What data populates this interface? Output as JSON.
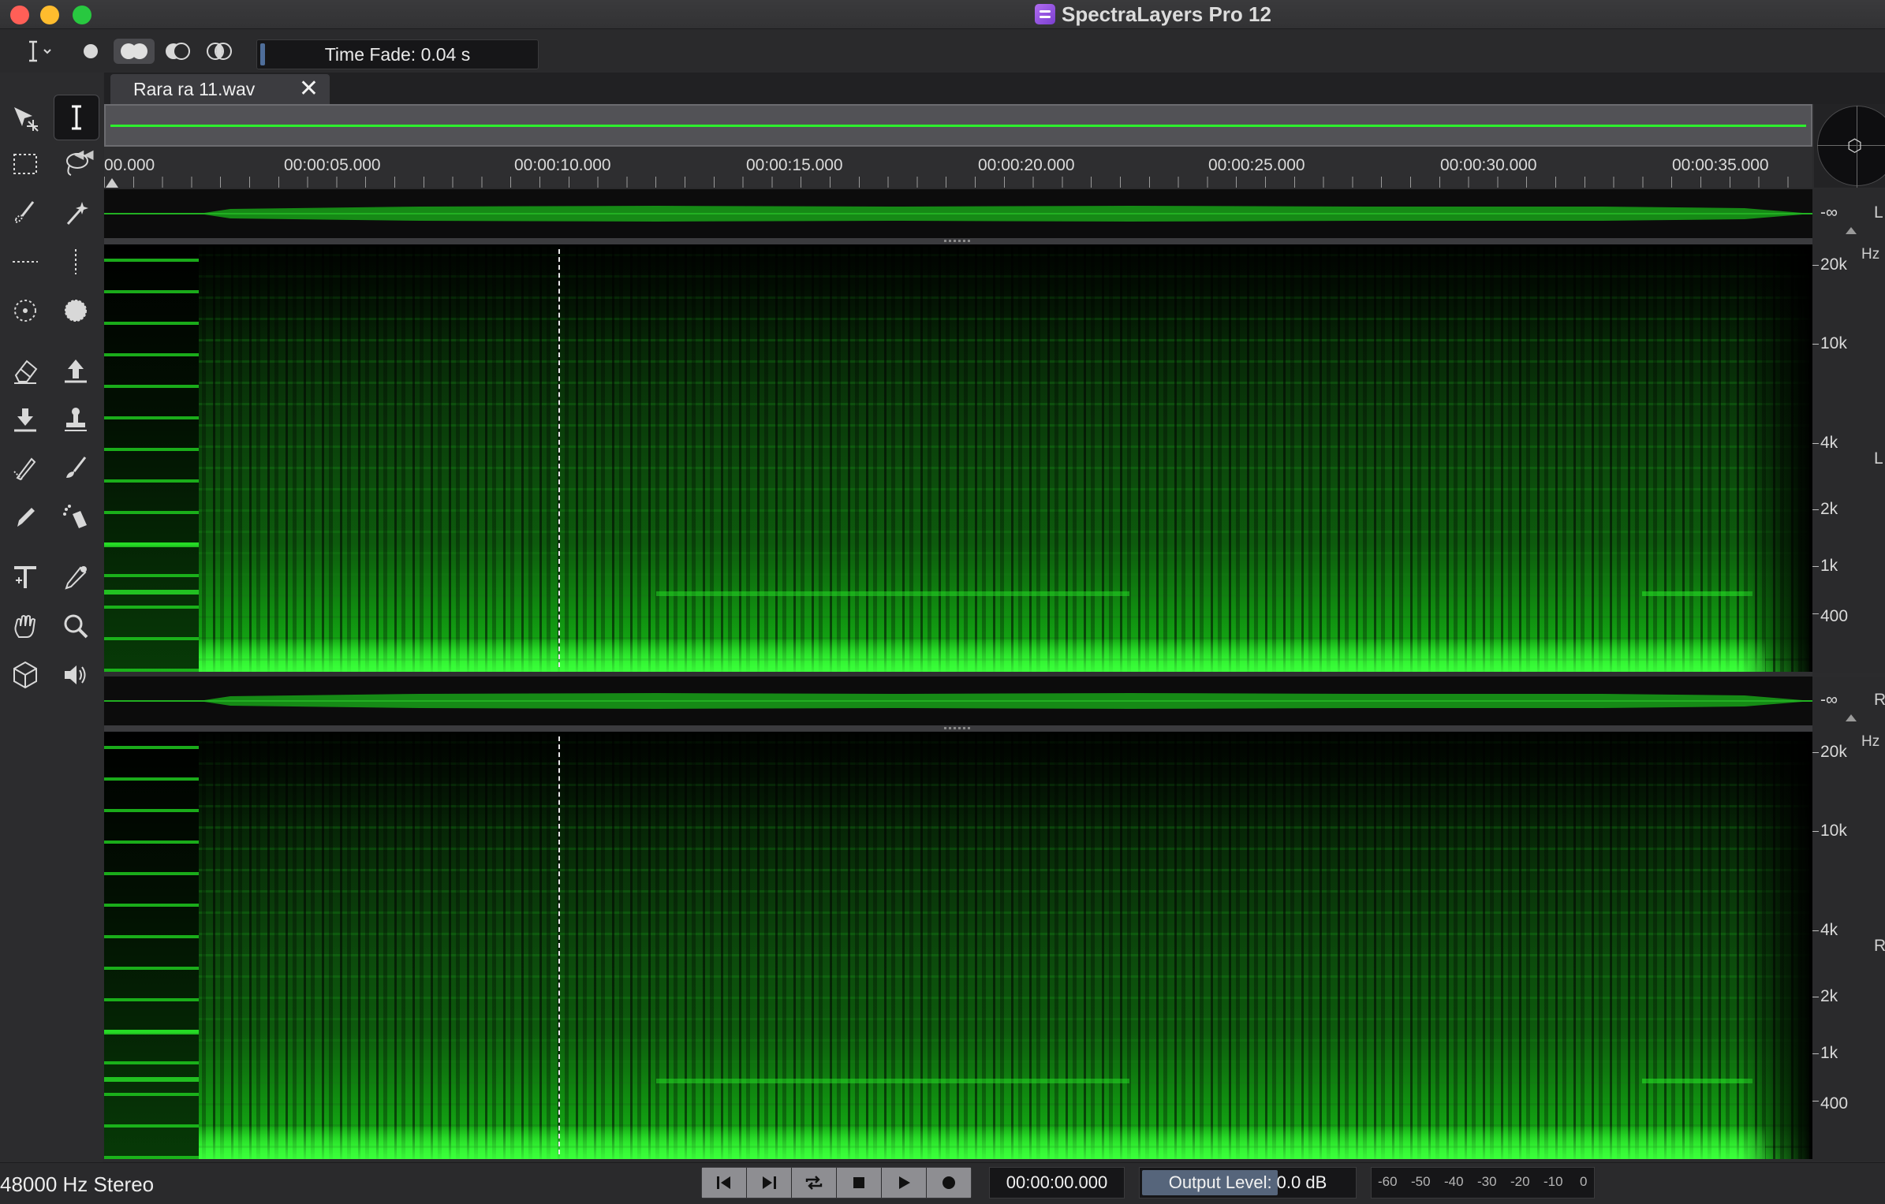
{
  "window": {
    "title": "SpectraLayers Pro 12"
  },
  "toolbar": {
    "cursor_icon": "text-cursor-icon",
    "time_fade": "Time Fade: 0.04 s"
  },
  "tab": {
    "filename": "Rara ra 11.wav"
  },
  "ruler": {
    "labels": [
      "00.000",
      "00:00:05.000",
      "00:00:10.000",
      "00:00:15.000",
      "00:00:20.000",
      "00:00:25.000",
      "00:00:30.000",
      "00:00:35.000"
    ]
  },
  "channels": {
    "left": {
      "label": "L",
      "peak": "-∞",
      "unit": "Hz",
      "freq_labels": [
        "20k",
        "10k",
        "4k",
        "2k",
        "1k",
        "400"
      ]
    },
    "right": {
      "label": "R",
      "peak": "-∞",
      "unit": "Hz",
      "freq_labels": [
        "20k",
        "10k",
        "4k",
        "2k",
        "1k",
        "400"
      ]
    }
  },
  "status": {
    "format": "48000 Hz Stereo",
    "timecode": "00:00:00.000",
    "output_level": "Output Level: 0.0 dB",
    "output_level_fraction": 0.64,
    "meter_scale": [
      "-60",
      "-50",
      "-40",
      "-30",
      "-20",
      "-10",
      "0"
    ]
  },
  "colors": {
    "accent": "#2df02d",
    "close": "#ff5f57",
    "minimize": "#febc2e",
    "zoom": "#28c840"
  }
}
